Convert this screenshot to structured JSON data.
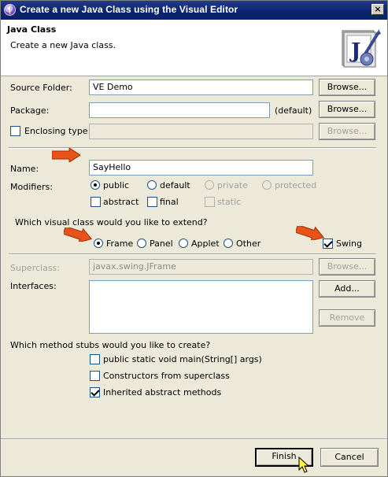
{
  "window": {
    "title": "Create a new Java Class using the Visual Editor",
    "close_glyph": "×"
  },
  "header": {
    "title": "Java Class",
    "description": "Create a new Java class.",
    "image_icon": "java-class-wizard-icon"
  },
  "form": {
    "source_folder": {
      "label": "Source Folder:",
      "value": "VE Demo",
      "button": "Browse..."
    },
    "package": {
      "label": "Package:",
      "value": "",
      "suffix": "(default)",
      "button": "Browse..."
    },
    "enclosing_type": {
      "label": "Enclosing type:",
      "checked": false,
      "value": "",
      "button": "Browse..."
    },
    "name": {
      "label": "Name:",
      "value": "SayHello"
    },
    "modifiers": {
      "label": "Modifiers:",
      "access": [
        {
          "label": "public",
          "selected": true,
          "enabled": true
        },
        {
          "label": "default",
          "selected": false,
          "enabled": true
        },
        {
          "label": "private",
          "selected": false,
          "enabled": false
        },
        {
          "label": "protected",
          "selected": false,
          "enabled": false
        }
      ],
      "other": [
        {
          "label": "abstract",
          "checked": false,
          "enabled": true
        },
        {
          "label": "final",
          "checked": false,
          "enabled": true
        },
        {
          "label": "static",
          "checked": false,
          "enabled": false
        }
      ]
    },
    "visual_class": {
      "question": "Which visual class would you like to extend?",
      "options": [
        {
          "label": "Frame",
          "selected": true
        },
        {
          "label": "Panel",
          "selected": false
        },
        {
          "label": "Applet",
          "selected": false
        },
        {
          "label": "Other",
          "selected": false
        }
      ],
      "swing": {
        "label": "Swing",
        "checked": true
      }
    },
    "superclass": {
      "label": "Superclass:",
      "value": "javax.swing.JFrame",
      "button": "Browse..."
    },
    "interfaces": {
      "label": "Interfaces:",
      "items": [],
      "add_button": "Add...",
      "remove_button": "Remove"
    },
    "stubs": {
      "question": "Which method stubs would you like to create?",
      "items": [
        {
          "label": "public static void main(String[] args)",
          "checked": false
        },
        {
          "label": "Constructors from superclass",
          "checked": false
        },
        {
          "label": "Inherited abstract methods",
          "checked": true
        }
      ]
    }
  },
  "footer": {
    "finish": "Finish",
    "cancel": "Cancel"
  },
  "colors": {
    "titlebar": "#0a246a",
    "dialog_bg": "#ece9d8",
    "arrow": "#e8531a",
    "field_border": "#7f9db9"
  }
}
